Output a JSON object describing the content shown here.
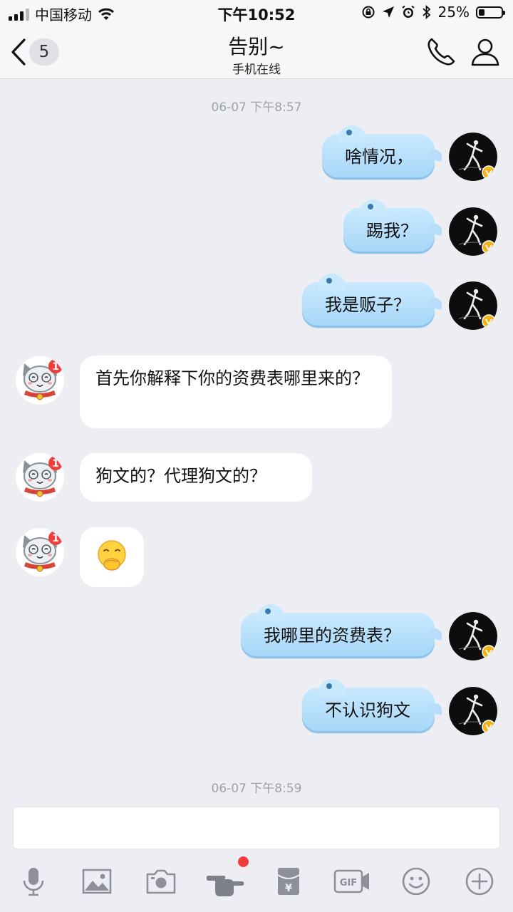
{
  "status_bar": {
    "carrier": "中国移动",
    "time": "下午10:52",
    "battery": "25%",
    "battery_level": 0.25
  },
  "nav": {
    "back_badge": "5",
    "title": "告别~",
    "subtitle": "手机在线",
    "icons": [
      "back-chevron-icon",
      "phone-icon",
      "profile-icon"
    ]
  },
  "chat": {
    "timestamp_top": "06-07 下午8:57",
    "messages": [
      {
        "from": "me",
        "text": "啥情况，"
      },
      {
        "from": "me",
        "text": "踢我？"
      },
      {
        "from": "me",
        "text": "我是贩子？"
      },
      {
        "from": "them",
        "text": "首先你解释下你的资费表哪里来的？"
      },
      {
        "from": "them",
        "text": "狗文的？代理狗文的？"
      },
      {
        "from": "them",
        "emoji": "face-covering-mouth-emoji"
      },
      {
        "from": "me",
        "text": "我哪里的资费表？"
      },
      {
        "from": "me",
        "text": "不认识狗文"
      }
    ],
    "timestamp_bottom": "06-07 下午8:59",
    "other_avatar_badge": "1"
  },
  "toolbar": {
    "icons": [
      "microphone-icon",
      "image-icon",
      "camera-icon",
      "poke-hand-icon",
      "red-packet-icon",
      "gif-icon",
      "emoji-icon",
      "plus-icon"
    ]
  },
  "colors": {
    "outgoing_bubble": "#b0dcf8",
    "incoming_bubble": "#ffffff",
    "background": "#eceef3",
    "notification_dot": "#f23d3d"
  }
}
